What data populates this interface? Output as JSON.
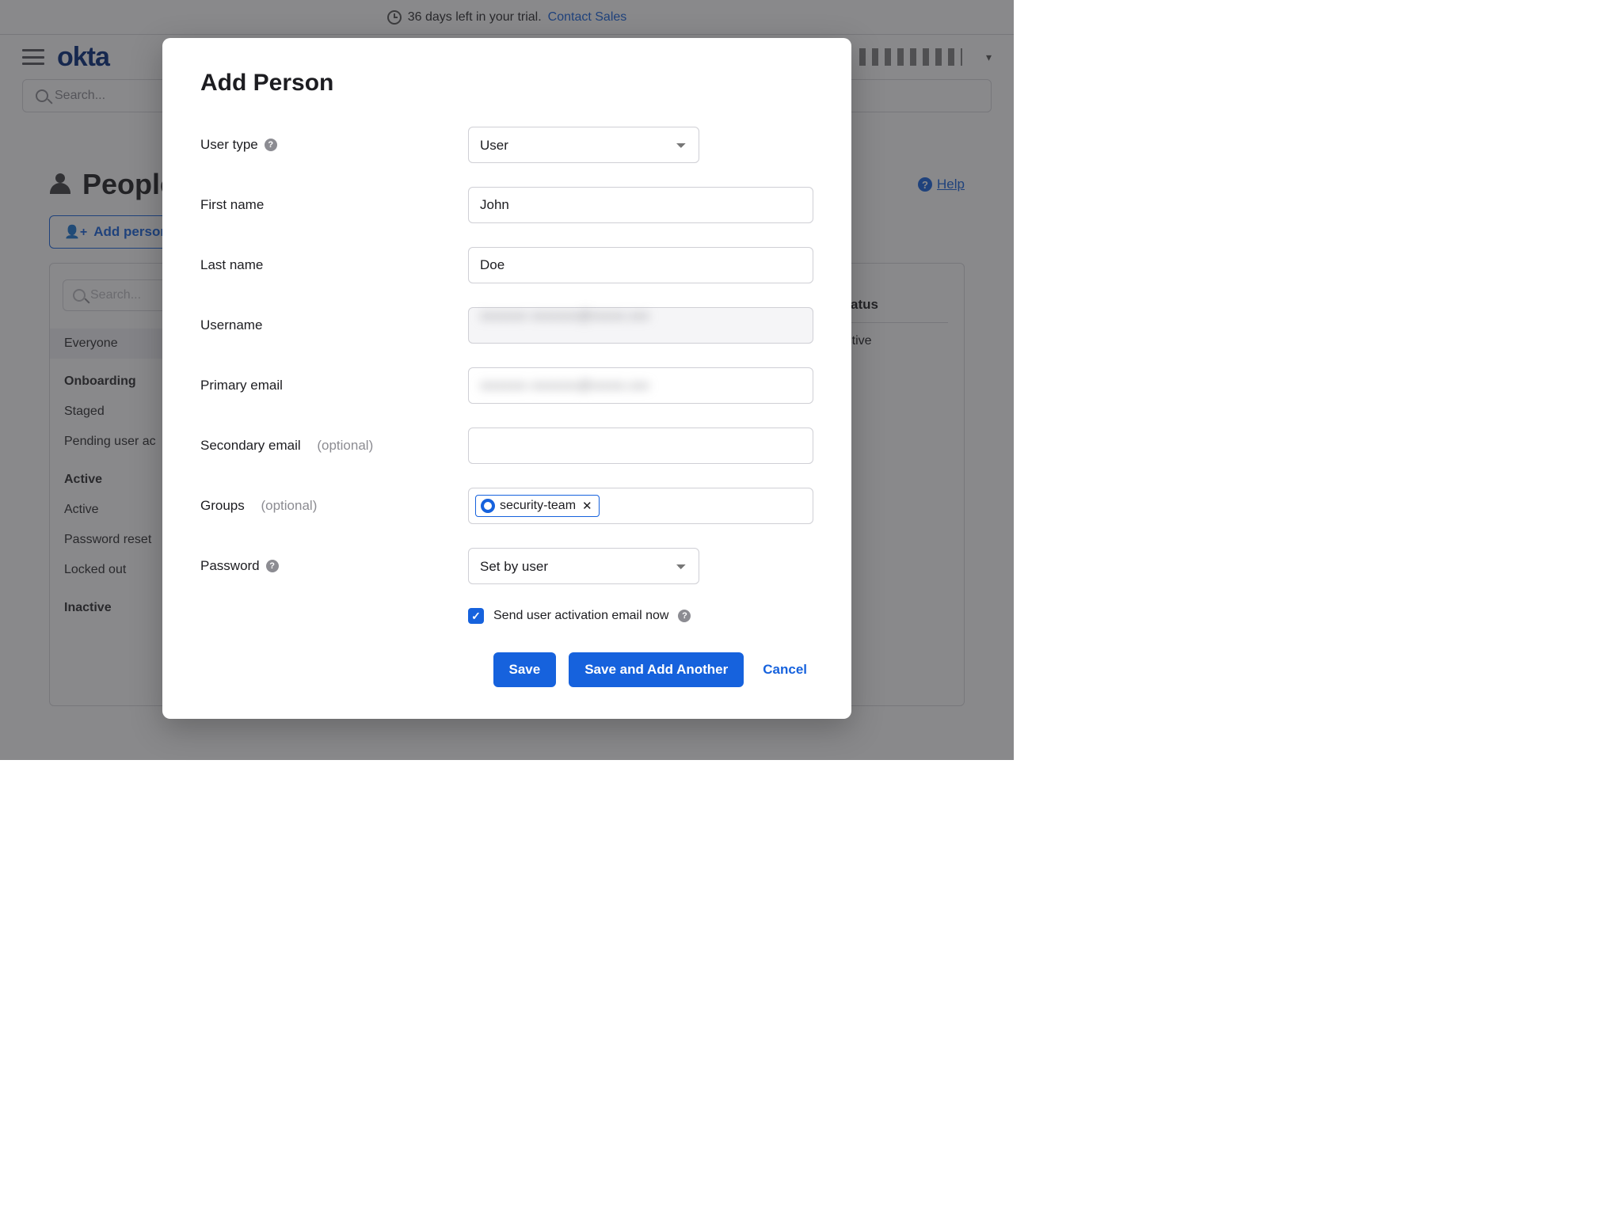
{
  "trial": {
    "text": "36 days left in your trial.",
    "link_label": "Contact Sales"
  },
  "search": {
    "placeholder": "Search..."
  },
  "page": {
    "title": "People",
    "help_label": "Help",
    "add_person_label": "Add person"
  },
  "sidebar": {
    "search_placeholder": "Search...",
    "filters": {
      "everyone": "Everyone",
      "onboarding_heading": "Onboarding",
      "staged": "Staged",
      "pending": "Pending user ac",
      "active_heading": "Active",
      "active": "Active",
      "password_reset": "Password reset",
      "locked_out": "Locked out",
      "inactive_heading": "Inactive"
    }
  },
  "table": {
    "status_header": "Status",
    "row_status": "Active"
  },
  "modal": {
    "title": "Add Person",
    "labels": {
      "user_type": "User type",
      "first_name": "First name",
      "last_name": "Last name",
      "username": "Username",
      "primary_email": "Primary email",
      "secondary_email": "Secondary email",
      "groups": "Groups",
      "password": "Password",
      "optional": "(optional)"
    },
    "values": {
      "user_type": "User",
      "first_name": "John",
      "last_name": "Doe",
      "username_masked": "xxxxxxx xxxxxxx@xxxxx.xxx",
      "primary_email_masked": "xxxxxxx xxxxxxx@xxxxx.xxx",
      "secondary_email": "",
      "password_option": "Set by user"
    },
    "groups_selected": "security-team",
    "activation_label": "Send user activation email now",
    "activation_checked": true,
    "buttons": {
      "save": "Save",
      "save_add": "Save and Add Another",
      "cancel": "Cancel"
    }
  }
}
